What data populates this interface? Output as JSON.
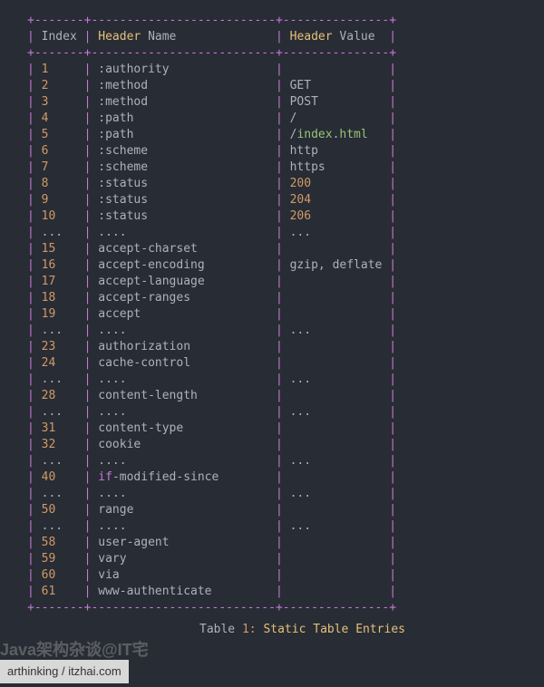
{
  "header": {
    "col1": "Index",
    "col2a": "Header",
    "col2b": "Name",
    "col3a": "Header",
    "col3b": "Value"
  },
  "rows": [
    {
      "idx": "1",
      "name": [
        ":authority"
      ],
      "val": []
    },
    {
      "idx": "2",
      "name": [
        ":method"
      ],
      "val": [
        "GET"
      ]
    },
    {
      "idx": "3",
      "name": [
        ":method"
      ],
      "val": [
        "POST"
      ]
    },
    {
      "idx": "4",
      "name": [
        ":path"
      ],
      "val": [
        "/"
      ]
    },
    {
      "idx": "5",
      "name": [
        ":path"
      ],
      "val": [
        "/",
        "index",
        ".",
        "html"
      ],
      "valClasses": [
        "",
        "str",
        "",
        "str"
      ]
    },
    {
      "idx": "6",
      "name": [
        ":scheme"
      ],
      "val": [
        "http"
      ]
    },
    {
      "idx": "7",
      "name": [
        ":scheme"
      ],
      "val": [
        "https"
      ]
    },
    {
      "idx": "8",
      "name": [
        ":status"
      ],
      "val": [
        "200"
      ],
      "valClasses": [
        "num"
      ]
    },
    {
      "idx": "9",
      "name": [
        ":status"
      ],
      "val": [
        "204"
      ],
      "valClasses": [
        "num"
      ]
    },
    {
      "idx": "10",
      "name": [
        ":status"
      ],
      "val": [
        "206"
      ],
      "valClasses": [
        "num"
      ]
    },
    {
      "idx": "...",
      "name": [
        "...."
      ],
      "val": [
        "..."
      ]
    },
    {
      "idx": "15",
      "name": [
        "accept-charset"
      ],
      "val": []
    },
    {
      "idx": "16",
      "name": [
        "accept-encoding"
      ],
      "val": [
        "gzip, deflate"
      ]
    },
    {
      "idx": "17",
      "name": [
        "accept-language"
      ],
      "val": []
    },
    {
      "idx": "18",
      "name": [
        "accept-ranges"
      ],
      "val": []
    },
    {
      "idx": "19",
      "name": [
        "accept"
      ],
      "val": []
    },
    {
      "idx": "...",
      "name": [
        "...."
      ],
      "val": [
        "..."
      ]
    },
    {
      "idx": "23",
      "name": [
        "authorization"
      ],
      "val": []
    },
    {
      "idx": "24",
      "name": [
        "cache-control"
      ],
      "val": []
    },
    {
      "idx": "...",
      "name": [
        "...."
      ],
      "val": [
        "..."
      ]
    },
    {
      "idx": "28",
      "name": [
        "content-length"
      ],
      "val": []
    },
    {
      "idx": "...",
      "name": [
        "...."
      ],
      "val": [
        "..."
      ]
    },
    {
      "idx": "31",
      "name": [
        "content-type"
      ],
      "val": []
    },
    {
      "idx": "32",
      "name": [
        "cookie"
      ],
      "val": []
    },
    {
      "idx": "...",
      "name": [
        "...."
      ],
      "val": [
        "..."
      ]
    },
    {
      "idx": "40",
      "name": [
        "if",
        "-modified-since"
      ],
      "nameClasses": [
        "kw",
        ""
      ],
      "val": []
    },
    {
      "idx": "...",
      "name": [
        "...."
      ],
      "val": [
        "..."
      ]
    },
    {
      "idx": "50",
      "name": [
        "range"
      ],
      "val": []
    },
    {
      "idx": "...",
      "name": [
        "...."
      ],
      "val": [
        "..."
      ]
    },
    {
      "idx": "58",
      "name": [
        "user-agent"
      ],
      "val": []
    },
    {
      "idx": "59",
      "name": [
        "vary"
      ],
      "val": []
    },
    {
      "idx": "60",
      "name": [
        "via"
      ],
      "val": []
    },
    {
      "idx": "61",
      "name": [
        "www-authenticate"
      ],
      "val": []
    }
  ],
  "caption": {
    "tableWord": "Table",
    "numWord": "1",
    "colon": ":",
    "title": "Static Table Entries"
  },
  "watermark": "Java架构杂谈@IT宅",
  "source": "arthinking / itzhai.com"
}
